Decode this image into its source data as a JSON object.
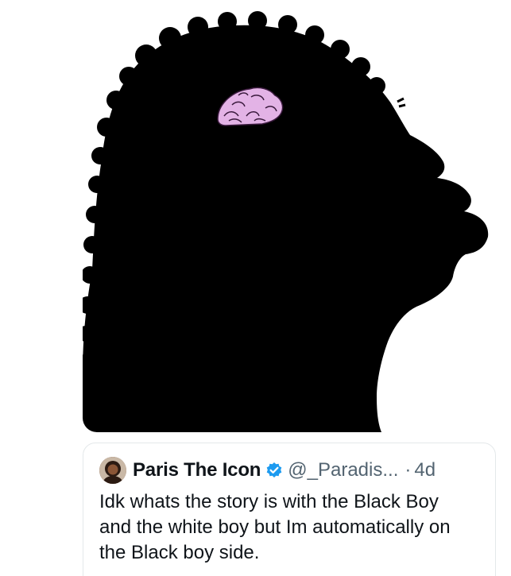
{
  "media": {
    "image_icon": "black-silhouette-with-pink-brain",
    "colors": {
      "silhouette": "#000000",
      "brain": "#e3b3e6",
      "brain_outline": "#3a1a3d"
    }
  },
  "quote_tweet": {
    "display_name": "Paris The Icon",
    "handle": "@_Paradis...",
    "separator": "·",
    "timestamp": "4d",
    "text": "Idk whats the story is with the Black Boy and the white boy but Im automatically on the Black boy side.",
    "avatar_icon": "user-avatar",
    "verified_icon": "verified-badge",
    "colors": {
      "verified": "#1d9bf0",
      "name": "#0f1419",
      "secondary": "#536471",
      "border": "#e4e8ea"
    }
  }
}
